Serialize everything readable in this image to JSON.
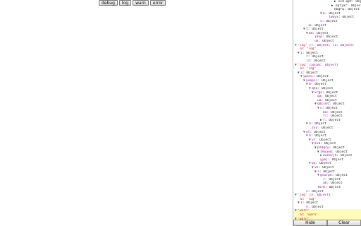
{
  "toolbar": {
    "buttons": [
      "debug",
      "log",
      "warn",
      "error"
    ]
  },
  "console": {
    "rows": [
      {
        "i": 13,
        "tri": "",
        "t": "",
        "type": "v",
        "text": "▶ ssd.apt: Object"
      },
      {
        "i": 12,
        "tri": "",
        "t": "",
        "type": "v",
        "text": "▶ zqfjar: Object"
      },
      {
        "i": 13,
        "tri": "",
        "t": "",
        "type": "v",
        "text": "kbgfq: Object"
      },
      {
        "i": 9,
        "tri": "▼",
        "k": "k",
        "v": "Object"
      },
      {
        "i": 11,
        "tri": "",
        "k": "tuwyx",
        "v": "Object"
      },
      {
        "i": 8,
        "tri": "",
        "k": "v",
        "v": "Object"
      },
      {
        "i": 4,
        "tri": "",
        "k": "m",
        "v": "Object"
      },
      {
        "i": 3,
        "tri": "▼",
        "k": "t",
        "v": "Object"
      },
      {
        "i": 4,
        "tri": "▼",
        "k": "bd",
        "v": "Object"
      },
      {
        "i": 6,
        "tri": "",
        "k": "jdvp",
        "v": "Object"
      },
      {
        "i": 6,
        "tri": "",
        "k": "uk",
        "v": "Object"
      },
      {
        "i": 0,
        "tri": "▼",
        "type": "head",
        "s": "\"log\"",
        "m": "{r: Object, lz: Object}"
      },
      {
        "i": 1,
        "tri": "",
        "k": "0",
        "s": "\"log\""
      },
      {
        "i": 1,
        "tri": "▼",
        "k": "1",
        "v": "Object"
      },
      {
        "i": 3,
        "tri": "",
        "k": "r",
        "v": "Object"
      },
      {
        "i": 3,
        "tri": "",
        "k": "lz",
        "v": "Object"
      },
      {
        "i": 0,
        "tri": "▼",
        "type": "head",
        "s": "\"log\"",
        "m": "{ywiec: Object}"
      },
      {
        "i": 1,
        "tri": "",
        "k": "0",
        "s": "\"log\""
      },
      {
        "i": 1,
        "tri": "▼",
        "k": "1",
        "v": "Object"
      },
      {
        "i": 2,
        "tri": "▼",
        "k": "ywiec",
        "v": "Object"
      },
      {
        "i": 3,
        "tri": "▼",
        "k": "yoopil",
        "v": "Object"
      },
      {
        "i": 4,
        "tri": "▼",
        "k": "b",
        "v": "Object"
      },
      {
        "i": 5,
        "tri": "▼",
        "k": "qhq",
        "v": "Object"
      },
      {
        "i": 6,
        "tri": "▼",
        "k": "xrgo",
        "v": "Object"
      },
      {
        "i": 7,
        "tri": "",
        "k": "qa",
        "v": "Object"
      },
      {
        "i": 7,
        "tri": "",
        "k": "ua",
        "v": "Object"
      },
      {
        "i": 7,
        "tri": "▼",
        "k": "qdcsmt",
        "v": "Object"
      },
      {
        "i": 8,
        "tri": "▼",
        "k": "c",
        "v": "Object"
      },
      {
        "i": 9,
        "tri": "",
        "k": "bd",
        "v": "Object"
      },
      {
        "i": 9,
        "tri": "",
        "k": "fl",
        "v": "Object"
      },
      {
        "i": 9,
        "tri": "▶",
        "k": "r",
        "v": "Object"
      },
      {
        "i": 4,
        "tri": "▼",
        "k": "a",
        "v": "Object"
      },
      {
        "i": 5,
        "tri": "",
        "k": "zxu",
        "v": "Object"
      },
      {
        "i": 3,
        "tri": "▼",
        "k": "ut",
        "v": "Object"
      },
      {
        "i": 4,
        "tri": "▼",
        "k": "a",
        "v": "Object"
      },
      {
        "i": 5,
        "tri": "▼",
        "k": "vr",
        "v": "Object"
      },
      {
        "i": 6,
        "tri": "▼",
        "k": "zsd",
        "v": "Object"
      },
      {
        "i": 7,
        "tri": "▼",
        "k": "pzdqcy",
        "v": "Object"
      },
      {
        "i": 8,
        "tri": "▼",
        "k": "teuand",
        "v": "Object"
      },
      {
        "i": 9,
        "tri": "▶",
        "k": "ewzovjk",
        "v": "Object"
      },
      {
        "i": 8,
        "tri": "",
        "k": "yyej",
        "v": "Object"
      },
      {
        "i": 5,
        "tri": "▼",
        "k": "ou",
        "v": "Object"
      },
      {
        "i": 6,
        "tri": "▼",
        "k": "vz",
        "v": "Object"
      },
      {
        "i": 7,
        "tri": "▼",
        "k": "l",
        "v": "Object"
      },
      {
        "i": 8,
        "tri": "▼",
        "k": "gsurpn",
        "v": "Object"
      },
      {
        "i": 9,
        "tri": "",
        "k": "r",
        "v": "Object"
      },
      {
        "i": 9,
        "tri": "",
        "k": "ub",
        "v": "Object"
      },
      {
        "i": 7,
        "tri": "",
        "k": "torm",
        "v": "Object"
      },
      {
        "i": 3,
        "tri": "",
        "k": "s",
        "v": "Object"
      },
      {
        "i": 0,
        "tri": "▼",
        "type": "head",
        "s": "\"log\"",
        "m": "{y: Object}"
      },
      {
        "i": 1,
        "tri": "",
        "k": "0",
        "s": "\"log\""
      },
      {
        "i": 1,
        "tri": "▼",
        "k": "1",
        "v": "Object"
      },
      {
        "i": 3,
        "tri": "",
        "k": "y",
        "v": "Object"
      },
      {
        "i": 0,
        "tri": "▼",
        "type": "headwarn",
        "s": "\"warn\""
      },
      {
        "i": 1,
        "tri": "",
        "type": "warn",
        "k": "0",
        "s": "\"warn\""
      },
      {
        "i": 0,
        "tri": "▼",
        "type": "headwarn",
        "s": "\"warn\""
      },
      {
        "i": 1,
        "tri": "",
        "type": "warn",
        "k": "0",
        "s": "\"warn\""
      }
    ],
    "footer": {
      "hide_label": "Hide",
      "clear_label": "Clear"
    }
  }
}
